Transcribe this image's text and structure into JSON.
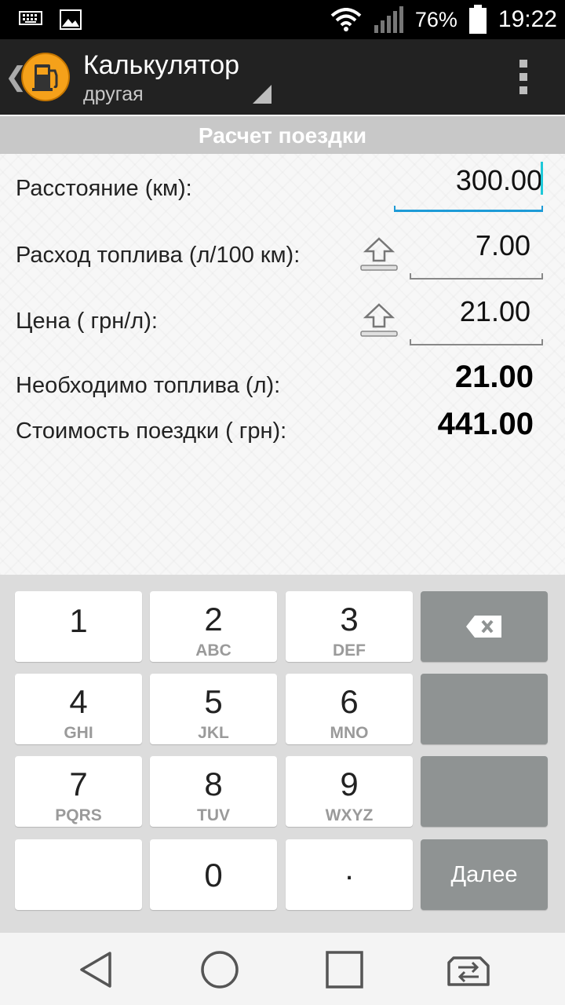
{
  "status_bar": {
    "battery": "76%",
    "time": "19:22"
  },
  "action_bar": {
    "title": "Калькулятор",
    "subtitle": "другая",
    "icons": [
      "back-chevron-icon",
      "fuel-pump-icon",
      "overflow-menu-icon"
    ]
  },
  "section": {
    "title": "Расчет поездки"
  },
  "form": {
    "distance_label": "Расстояние (км):",
    "distance_value": "300.00",
    "consumption_label": "Расход топлива (л/100 км):",
    "consumption_value": "7.00",
    "price_label": "Цена ( грн/л):",
    "price_value": "21.00",
    "fuel_needed_label": "Необходимо топлива (л):",
    "fuel_needed_value": "21.00",
    "trip_cost_label": "Стоимость поездки ( грн):",
    "trip_cost_value": "441.00"
  },
  "keyboard": {
    "keys": [
      {
        "num": "1",
        "letters": ""
      },
      {
        "num": "2",
        "letters": "ABC"
      },
      {
        "num": "3",
        "letters": "DEF"
      },
      {
        "num": "4",
        "letters": "GHI"
      },
      {
        "num": "5",
        "letters": "JKL"
      },
      {
        "num": "6",
        "letters": "MNO"
      },
      {
        "num": "7",
        "letters": "PQRS"
      },
      {
        "num": "8",
        "letters": "TUV"
      },
      {
        "num": "9",
        "letters": "WXYZ"
      },
      {
        "num": "0",
        "letters": ""
      },
      {
        "num": ".",
        "letters": ""
      }
    ],
    "next_label": "Далее"
  },
  "colors": {
    "accent": "#1e9bd7",
    "cursor": "#1ec8d8",
    "app_icon": "#f5a11a",
    "action_bar": "#222222"
  }
}
